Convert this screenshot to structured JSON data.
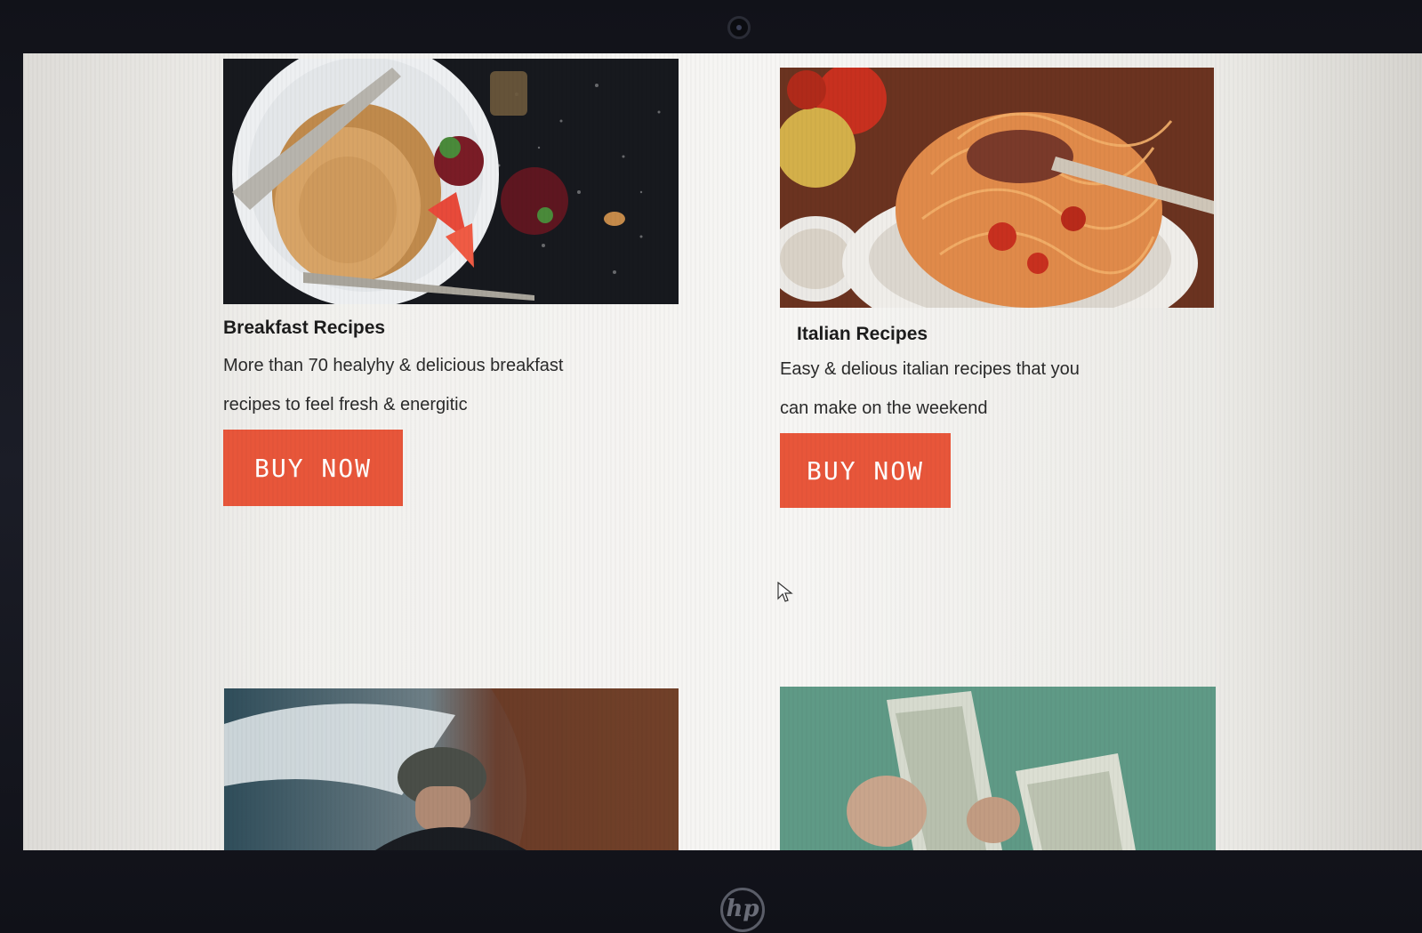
{
  "colors": {
    "accent": "#e8563a",
    "text": "#1c1c1c",
    "page_background": "#f5f4f1"
  },
  "cards": [
    {
      "title": "Breakfast Recipes",
      "description_lines": [
        "More than 70 healyhy & delicious  breakfast",
        "recipes to feel fresh & energitic"
      ],
      "button_label": "BUY NOW",
      "image": "pancakes-with-strawberries-photo"
    },
    {
      "title": "Italian Recipes",
      "description_lines": [
        "Easy & delious italian recipes that you",
        "can make on the weekend"
      ],
      "button_label": "BUY NOW",
      "image": "spaghetti-with-tomato-sauce-photo"
    },
    {
      "image": "hiker-with-cap-mountain-photo"
    },
    {
      "image": "hand-holding-dollar-bills-photo"
    }
  ],
  "device": {
    "brand_logo": "hp"
  },
  "icons": {
    "mouse_cursor": "arrow-pointer-icon"
  }
}
